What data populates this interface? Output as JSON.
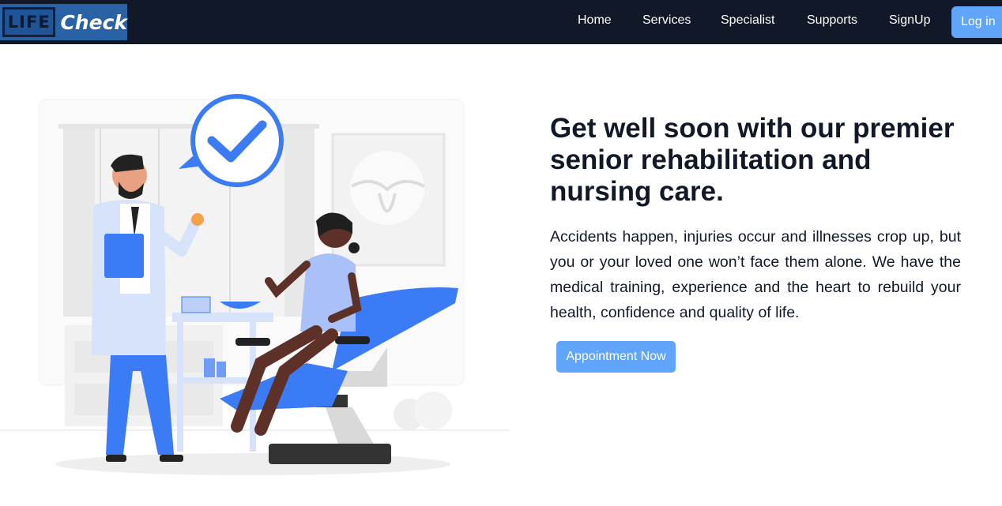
{
  "brand": {
    "part1": "LIFE",
    "part2": "Check"
  },
  "nav": {
    "items": [
      "Home",
      "Services",
      "Specialist",
      "Supports",
      "SignUp"
    ],
    "login_label": "Log in"
  },
  "hero": {
    "headline": "Get well soon with our premier senior rehabilitation and nursing care.",
    "paragraph": "Accidents happen, injuries occur and illnesses crop up, but you or your loved one won’t face them alone. We have the medical training, experience and the heart to rebuild your health, confidence and quality of life.",
    "cta_label": "Appointment Now"
  },
  "colors": {
    "navbar_bg": "#111827",
    "accent_button": "#60a5fa",
    "illustration_blue": "#3b7bf6",
    "logo_bg": "#2a62a6"
  }
}
